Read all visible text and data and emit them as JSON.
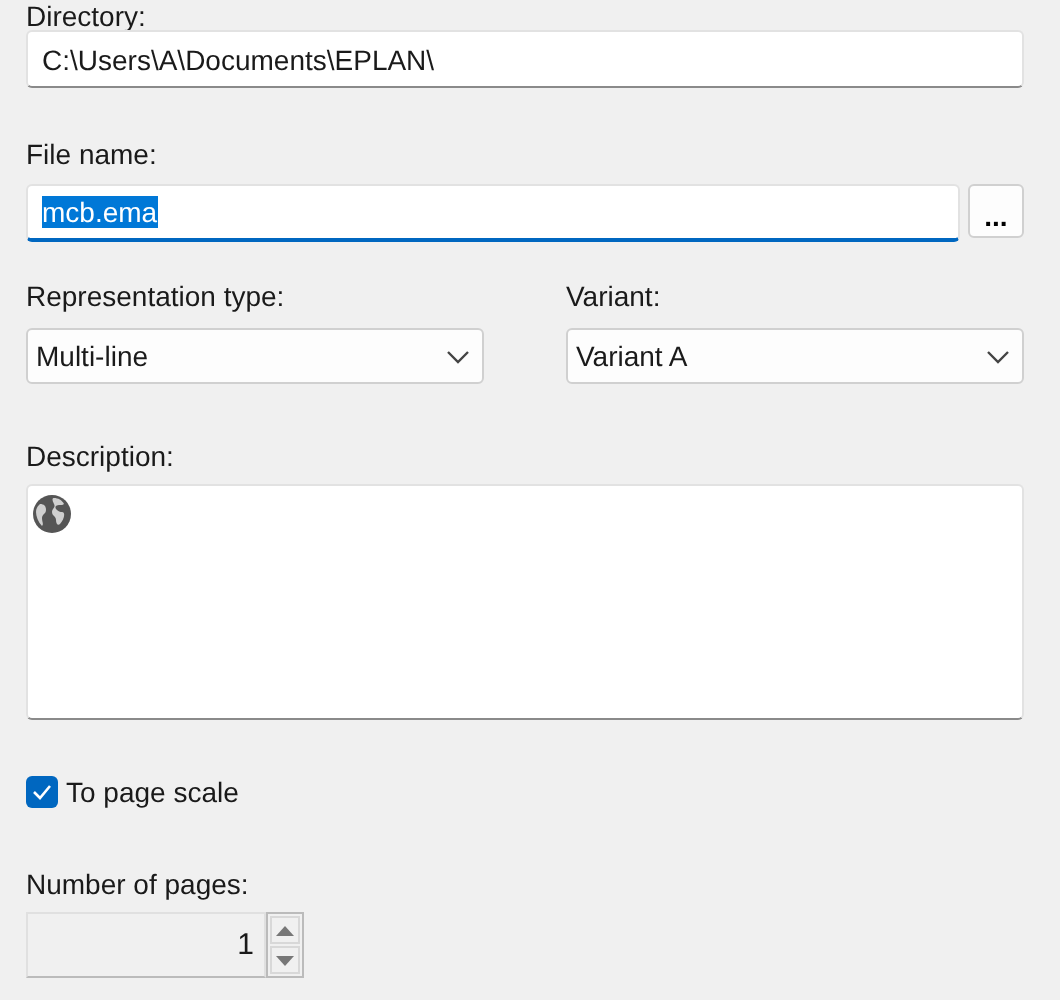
{
  "directory": {
    "label": "Directory:",
    "value": "C:\\Users\\A\\Documents\\EPLAN\\"
  },
  "file_name": {
    "label": "File name:",
    "value": "mcb.ema",
    "text_selected": true,
    "focused": true,
    "browse_button": "..."
  },
  "representation_type": {
    "label": "Representation type:",
    "value": "Multi-line"
  },
  "variant": {
    "label": "Variant:",
    "value": "Variant A"
  },
  "description": {
    "label": "Description:"
  },
  "to_page_scale": {
    "label": "To page scale",
    "checked": true
  },
  "number_of_pages": {
    "label": "Number of pages:",
    "value": "1"
  }
}
